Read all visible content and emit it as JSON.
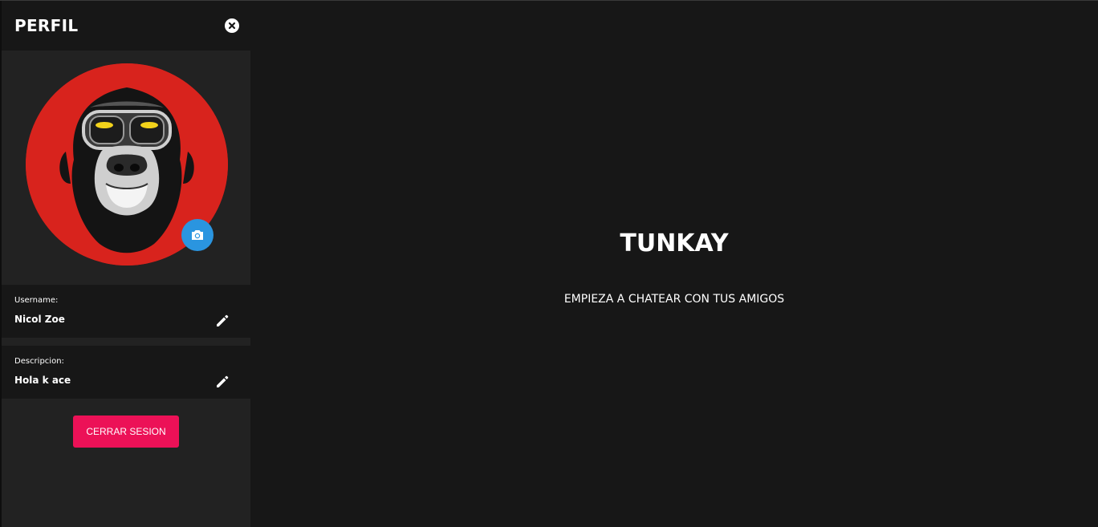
{
  "profile_panel": {
    "title": "PERFIL",
    "username": {
      "label": "Username:",
      "value": "Nicol Zoe"
    },
    "description": {
      "label": "Descripcion:",
      "value": "Hola k ace"
    },
    "logout_label": "CERRAR SESION"
  },
  "main": {
    "title": "TUNKAY",
    "subtitle": "EMPIEZA A CHATEAR CON TUS AMIGOS"
  },
  "colors": {
    "background": "#171717",
    "panel": "#222222",
    "logout_button": "#ec1157",
    "camera_button": "#2a95e0",
    "avatar_background": "#d8231d"
  },
  "icons": {
    "close": "close-icon",
    "camera": "camera-icon",
    "edit": "pencil-icon"
  }
}
